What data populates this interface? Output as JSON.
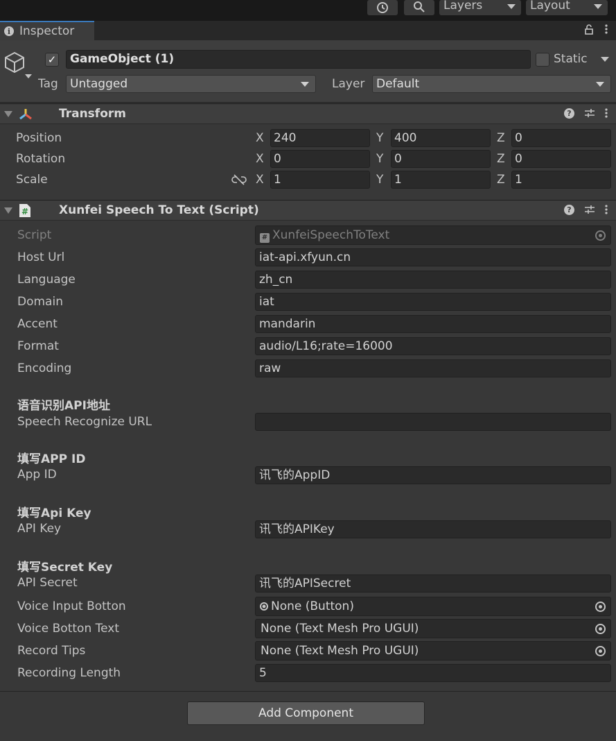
{
  "toolbar": {
    "history_icon": "history-icon",
    "search_icon": "search-icon",
    "layers_label": "Layers",
    "layout_label": "Layout"
  },
  "tab": {
    "label": "Inspector",
    "lock_icon": "lock-icon",
    "menu_icon": "kebab-menu-icon"
  },
  "gameobject": {
    "active": true,
    "name": "GameObject (1)",
    "static_label": "Static",
    "static_checked": false,
    "tag_label": "Tag",
    "tag_value": "Untagged",
    "layer_label": "Layer",
    "layer_value": "Default"
  },
  "transform": {
    "title": "Transform",
    "rows": [
      {
        "label": "Position",
        "x": "240",
        "y": "400",
        "z": "0"
      },
      {
        "label": "Rotation",
        "x": "0",
        "y": "0",
        "z": "0"
      },
      {
        "label": "Scale",
        "x": "1",
        "y": "1",
        "z": "1"
      }
    ],
    "axis_x": "X",
    "axis_y": "Y",
    "axis_z": "Z"
  },
  "script_component": {
    "title": "Xunfei Speech To Text (Script)",
    "script_label": "Script",
    "script_value": "XunfeiSpeechToText",
    "host_url_label": "Host Url",
    "host_url_value": "iat-api.xfyun.cn",
    "language_label": "Language",
    "language_value": "zh_cn",
    "domain_label": "Domain",
    "domain_value": "iat",
    "accent_label": "Accent",
    "accent_value": "mandarin",
    "format_label": "Format",
    "format_value": "audio/L16;rate=16000",
    "encoding_label": "Encoding",
    "encoding_value": "raw",
    "header_api_url": "语音识别API地址",
    "speech_url_label": "Speech Recognize URL",
    "speech_url_value": "",
    "header_app_id": "填写APP ID",
    "app_id_label": "App ID",
    "app_id_value": "讯飞的AppID",
    "header_api_key": "填写Api Key",
    "api_key_label": "API Key",
    "api_key_value": "讯飞的APIKey",
    "header_secret": "填写Secret Key",
    "api_secret_label": "API Secret",
    "api_secret_value": "讯飞的APISecret",
    "voice_input_label": "Voice Input Botton",
    "voice_input_value": "None (Button)",
    "voice_text_label": "Voice Botton Text",
    "voice_text_value": "None (Text Mesh Pro UGUI)",
    "record_tips_label": "Record Tips",
    "record_tips_value": "None (Text Mesh Pro UGUI)",
    "recording_length_label": "Recording Length",
    "recording_length_value": "5"
  },
  "add_component_label": "Add Component"
}
